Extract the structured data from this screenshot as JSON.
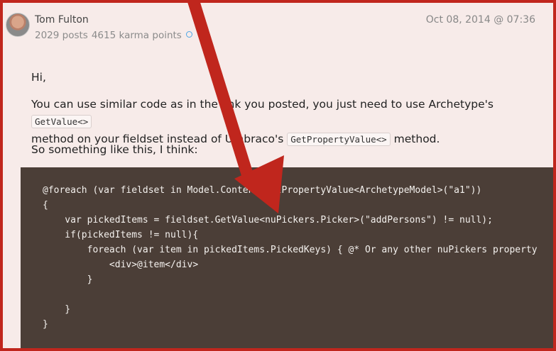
{
  "post": {
    "author": "Tom Fulton",
    "posts": "2029 posts",
    "karma": "4615 karma points",
    "date": "Oct 08, 2014 @ 07:36"
  },
  "message": {
    "greeting": "Hi,",
    "line1_before": "You can use similar code as in the link you posted, you just need to use Archetype's",
    "code1": "GetValue<>",
    "line2_before": "method on your fieldset instead of Umbraco's",
    "code2": "GetPropertyValue<>",
    "line2_after": "method.",
    "line3": "So something like this, I think:"
  },
  "code_block": {
    "lines": [
      "@foreach (var fieldset in Model.Content.GetPropertyValue<ArchetypeModel>(\"a1\"))",
      "{",
      "    var pickedItems = fieldset.GetValue<nuPickers.Picker>(\"addPersons\") != null);",
      "    if(pickedItems != null){",
      "        foreach (var item in pickedItems.PickedKeys) { @* Or any other nuPickers property",
      "            <div>@item</div>",
      "        }",
      "",
      "    }",
      "}"
    ]
  },
  "colors": {
    "annotation_red": "#c0261d",
    "post_background": "#f7ebe9",
    "code_background": "#4b3e37"
  }
}
